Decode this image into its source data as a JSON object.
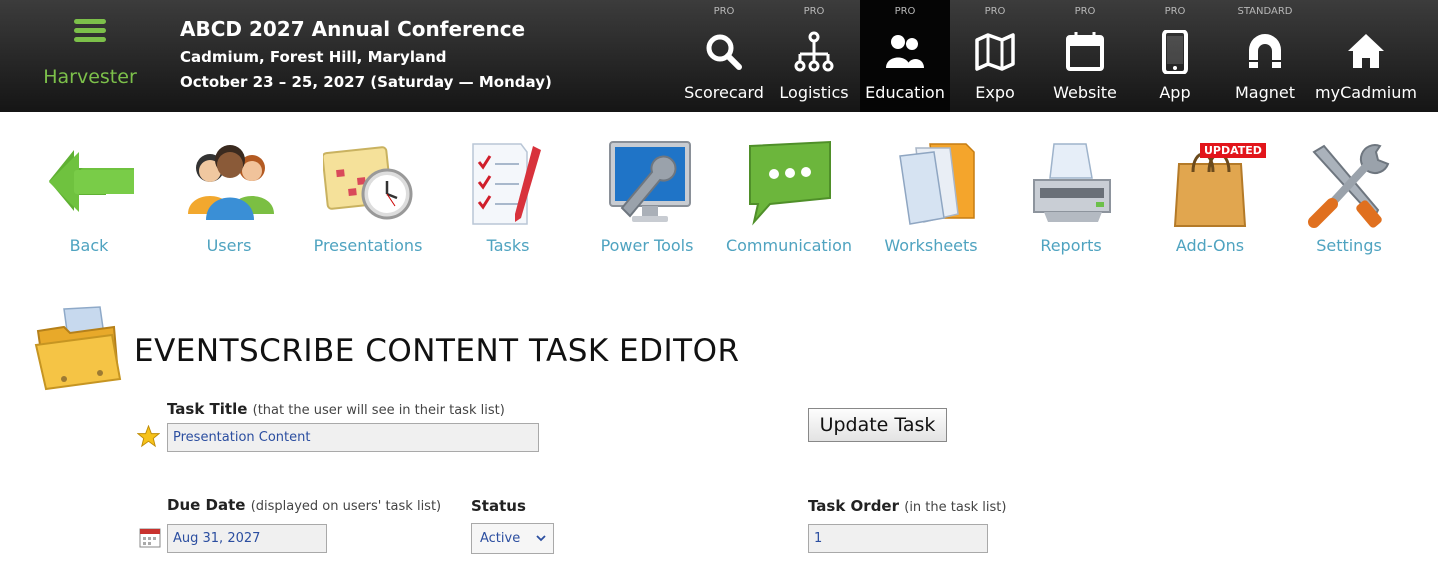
{
  "brand": {
    "name": "Harvester"
  },
  "event": {
    "title": "ABCD 2027 Annual Conference",
    "location": "Cadmium, Forest Hill, Maryland",
    "dates": "October 23 – 25, 2027 (Saturday — Monday)"
  },
  "topnav": [
    {
      "tier": "PRO",
      "label": "Scorecard",
      "icon": "search-icon"
    },
    {
      "tier": "PRO",
      "label": "Logistics",
      "icon": "org-chart-icon"
    },
    {
      "tier": "PRO",
      "label": "Education",
      "icon": "people-icon",
      "active": true
    },
    {
      "tier": "PRO",
      "label": "Expo",
      "icon": "map-icon"
    },
    {
      "tier": "PRO",
      "label": "Website",
      "icon": "calendar-icon"
    },
    {
      "tier": "PRO",
      "label": "App",
      "icon": "phone-icon"
    },
    {
      "tier": "STANDARD",
      "label": "Magnet",
      "icon": "magnet-icon"
    },
    {
      "tier": "",
      "label": "myCadmium",
      "icon": "home-icon"
    }
  ],
  "toolbar": [
    {
      "label": "Back",
      "icon": "back-arrow-icon"
    },
    {
      "label": "Users",
      "icon": "users-icon"
    },
    {
      "label": "Presentations",
      "icon": "presentations-icon"
    },
    {
      "label": "Tasks",
      "icon": "tasks-icon"
    },
    {
      "label": "Power Tools",
      "icon": "power-tools-icon"
    },
    {
      "label": "Communication",
      "icon": "communication-icon"
    },
    {
      "label": "Worksheets",
      "icon": "worksheets-icon"
    },
    {
      "label": "Reports",
      "icon": "reports-icon"
    },
    {
      "label": "Add-Ons",
      "icon": "add-ons-icon",
      "badge": "UPDATED"
    },
    {
      "label": "Settings",
      "icon": "settings-icon"
    }
  ],
  "editor": {
    "title": "EVENTSCRIBE CONTENT TASK EDITOR",
    "task_title": {
      "label": "Task Title",
      "note": "(that the user will see in their task list)",
      "value": "Presentation Content"
    },
    "update_button": "Update Task",
    "due_date": {
      "label": "Due Date",
      "note": "(displayed on users' task list)",
      "value": "Aug 31, 2027"
    },
    "status": {
      "label": "Status",
      "value": "Active"
    },
    "task_order": {
      "label": "Task Order",
      "note": "(in the task list)",
      "value": "1"
    }
  },
  "colors": {
    "accent_green": "#7cc04a",
    "link_blue": "#4fa3c0",
    "badge_red": "#e2151b",
    "input_text": "#2b4ea0"
  }
}
